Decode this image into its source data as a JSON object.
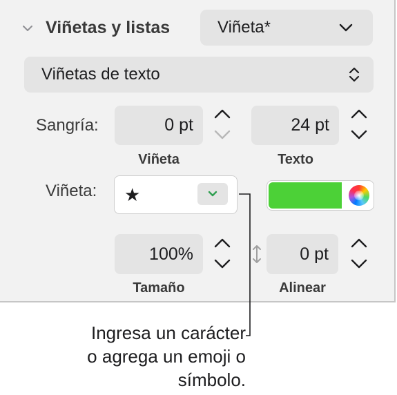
{
  "section": {
    "title": "Viñetas y listas",
    "style_popup": {
      "value": "Viñeta*"
    },
    "list_type_popup": {
      "value": "Viñetas de texto"
    }
  },
  "indent": {
    "label": "Sangría:",
    "bullet": {
      "value": "0 pt",
      "caption": "Viñeta"
    },
    "text": {
      "value": "24 pt",
      "caption": "Texto"
    }
  },
  "bullet": {
    "label": "Viñeta:",
    "character": "★",
    "color_hex": "#4cd137"
  },
  "size": {
    "value": "100%",
    "caption": "Tamaño"
  },
  "align": {
    "value": "0 pt",
    "caption": "Alinear"
  },
  "callout": {
    "line1": "Ingresa un carácter",
    "line2": "o agrega un emoji o",
    "line3": "símbolo."
  },
  "icons": {
    "section_toggle": "chevron-down-icon",
    "popup_arrow": "chevron-down-icon",
    "list_popup_arrow": "up-down-chevron-icon",
    "stepper": "stepper-arrows-icon",
    "link": "vertical-link-icon",
    "color_wheel": "color-wheel-icon",
    "star": "star-icon"
  },
  "colors": {
    "panel_bg": "#f2f2f2",
    "control_bg": "#e4e4e4",
    "accent_green": "#4cd137",
    "dropdown_arrow_green": "#2e9e4f"
  }
}
